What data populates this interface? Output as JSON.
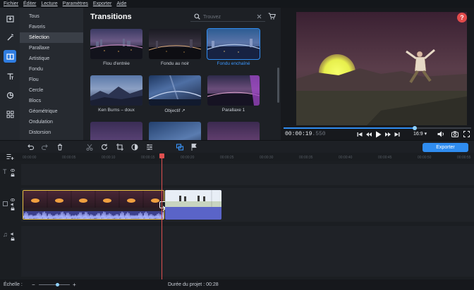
{
  "menu": [
    "Fichier",
    "Éditer",
    "Lecture",
    "Paramètres",
    "Exporter",
    "Aide"
  ],
  "sidebar_tools": [
    {
      "icon": "import-icon",
      "active": false
    },
    {
      "icon": "magic-wand-icon",
      "active": false
    },
    {
      "icon": "transitions-icon",
      "active": true
    },
    {
      "icon": "titles-icon",
      "active": false
    },
    {
      "icon": "stickers-icon",
      "active": false
    },
    {
      "icon": "more-tools-icon",
      "active": false
    }
  ],
  "categories": [
    "Tous",
    "Favoris",
    "Sélection",
    "Parallaxe",
    "Artistique",
    "Fondu",
    "Flou",
    "Cercle",
    "Blocs",
    "Géométrique",
    "Ondulation",
    "Distorsion"
  ],
  "selected_category": "Sélection",
  "gallery": {
    "title": "Transitions",
    "search_placeholder": "Trouvez",
    "items": [
      {
        "label": "Flou d'entrée",
        "selected": false
      },
      {
        "label": "Fondu au noir",
        "selected": false
      },
      {
        "label": "Fondu enchaîné",
        "selected": true
      },
      {
        "label": "Ken Burns – doux",
        "selected": false
      },
      {
        "label": "Objectif ↗",
        "selected": false
      },
      {
        "label": "Parallaxe 1",
        "selected": false
      },
      {
        "label": "",
        "selected": false
      },
      {
        "label": "",
        "selected": false
      },
      {
        "label": "",
        "selected": false
      }
    ]
  },
  "player": {
    "time_main": "00:00:19",
    "time_ms": ".550",
    "aspect": "16:9 ▾",
    "progress": 0.7
  },
  "toolbar": {
    "export_label": "Exporter"
  },
  "ruler_ticks": [
    "00:00:00",
    "00:00:05",
    "00:00:10",
    "00:00:15",
    "00:00:20",
    "00:00:25",
    "00:00:30",
    "00:00:35",
    "00:00:40",
    "00:00:45",
    "00:00:50",
    "00:00:55"
  ],
  "status": {
    "scale_label": "Échelle :",
    "duration_label": "Durée du projet : 00:28",
    "scale_value": 0.6
  },
  "colors": {
    "accent": "#2f8cf0",
    "playhead": "#e05050",
    "clip_border": "#e8c043",
    "audio": "#5a64c8"
  }
}
